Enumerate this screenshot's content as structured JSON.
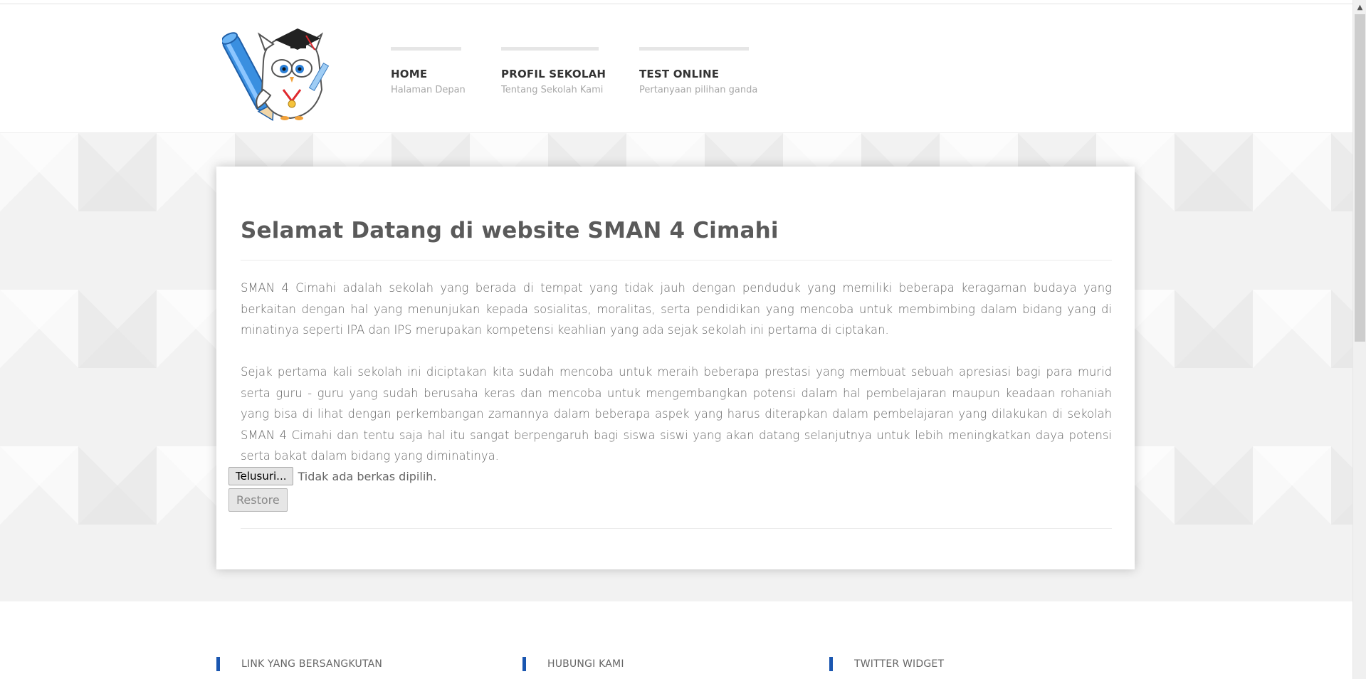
{
  "header": {
    "logo_alt": "SMAN 4 Cimahi owl mascot logo",
    "nav": [
      {
        "title": "HOME",
        "subtitle": "Halaman Depan"
      },
      {
        "title": "PROFIL SEKOLAH",
        "subtitle": "Tentang Sekolah Kami"
      },
      {
        "title": "TEST ONLINE",
        "subtitle": "Pertanyaan pilihan ganda"
      }
    ]
  },
  "main": {
    "title": "Selamat Datang di website SMAN 4 Cimahi",
    "paragraphs": [
      "SMAN 4 Cimahi adalah sekolah yang berada di tempat yang tidak jauh dengan penduduk yang memiliki beberapa keragaman budaya yang berkaitan dengan hal yang menunjukan kepada sosialitas, moralitas, serta pendidikan yang mencoba untuk membimbing dalam bidang yang di minatinya seperti IPA dan IPS merupakan kompetensi keahlian yang ada sejak sekolah ini pertama di ciptakan.",
      "Sejak pertama kali sekolah ini diciptakan kita sudah mencoba untuk meraih beberapa prestasi yang membuat sebuah apresiasi bagi para murid serta guru - guru yang sudah berusaha keras dan mencoba untuk mengembangkan potensi dalam hal pembelajaran maupun keadaan rohaniah yang bisa di lihat dengan perkembangan zamannya dalam beberapa aspek yang harus diterapkan dalam pembelajaran yang dilakukan di sekolah SMAN 4 Cimahi dan tentu saja hal itu sangat berpengaruh bagi siswa siswi yang akan datang selanjutnya untuk lebih meningkatkan daya potensi serta bakat dalam bidang yang diminatinya."
    ],
    "file_input": {
      "button_label": "Telusuri...",
      "status": "Tidak ada berkas dipilih."
    },
    "restore_label": "Restore"
  },
  "footer": {
    "headings": [
      "LINK YANG BERSANGKUTAN",
      "HUBUNGI KAMI",
      "TWITTER WIDGET"
    ]
  },
  "colors": {
    "accent": "#1a56b0",
    "background": "#f2f2f2",
    "title_text": "#5a5a5a"
  }
}
